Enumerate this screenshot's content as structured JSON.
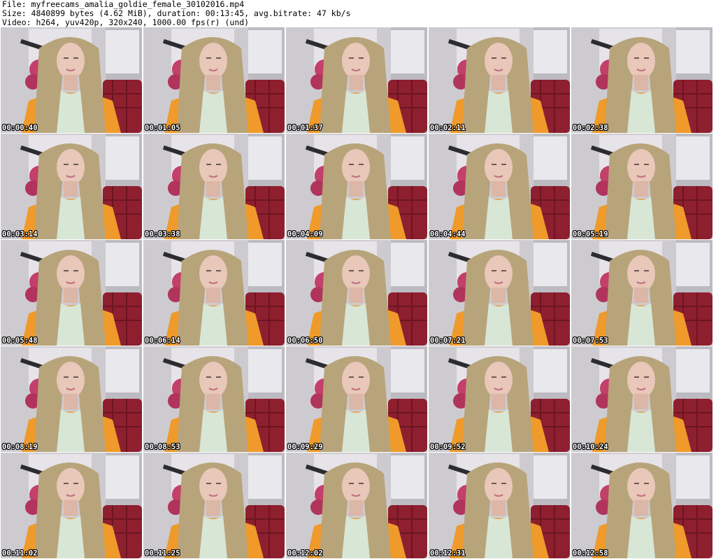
{
  "header": {
    "lines": [
      "File: myfreecams_amalia_goldie_female_30102016.mp4",
      "Size: 4840899 bytes (4.62 MiB), duration: 00:13:45, avg.bitrate: 47 kb/s",
      "Video: h264, yuv420p, 320x240, 1000.00 fps(r) (und)"
    ]
  },
  "grid": {
    "columns": 5,
    "rows": 5,
    "timestamps": [
      "00:00:40",
      "00:01:05",
      "00:01:37",
      "00:02:11",
      "00:02:38",
      "00:03:14",
      "00:03:38",
      "00:04:09",
      "00:04:44",
      "00:05:19",
      "00:05:48",
      "00:06:14",
      "00:06:50",
      "00:07:21",
      "00:07:53",
      "00:08:19",
      "00:08:53",
      "00:09:29",
      "00:09:52",
      "00:10:24",
      "00:11:02",
      "00:11:25",
      "00:12:02",
      "00:12:31",
      "00:12:58"
    ]
  },
  "colors": {
    "wall": "#cdcbd0",
    "picture_frame": "#e6e4e8",
    "rose": "#c2406a",
    "chair": "#8e1f2e",
    "hoodie": "#ef9a2a",
    "hair": "#b8a47a",
    "skin": "#e9c7b9"
  }
}
